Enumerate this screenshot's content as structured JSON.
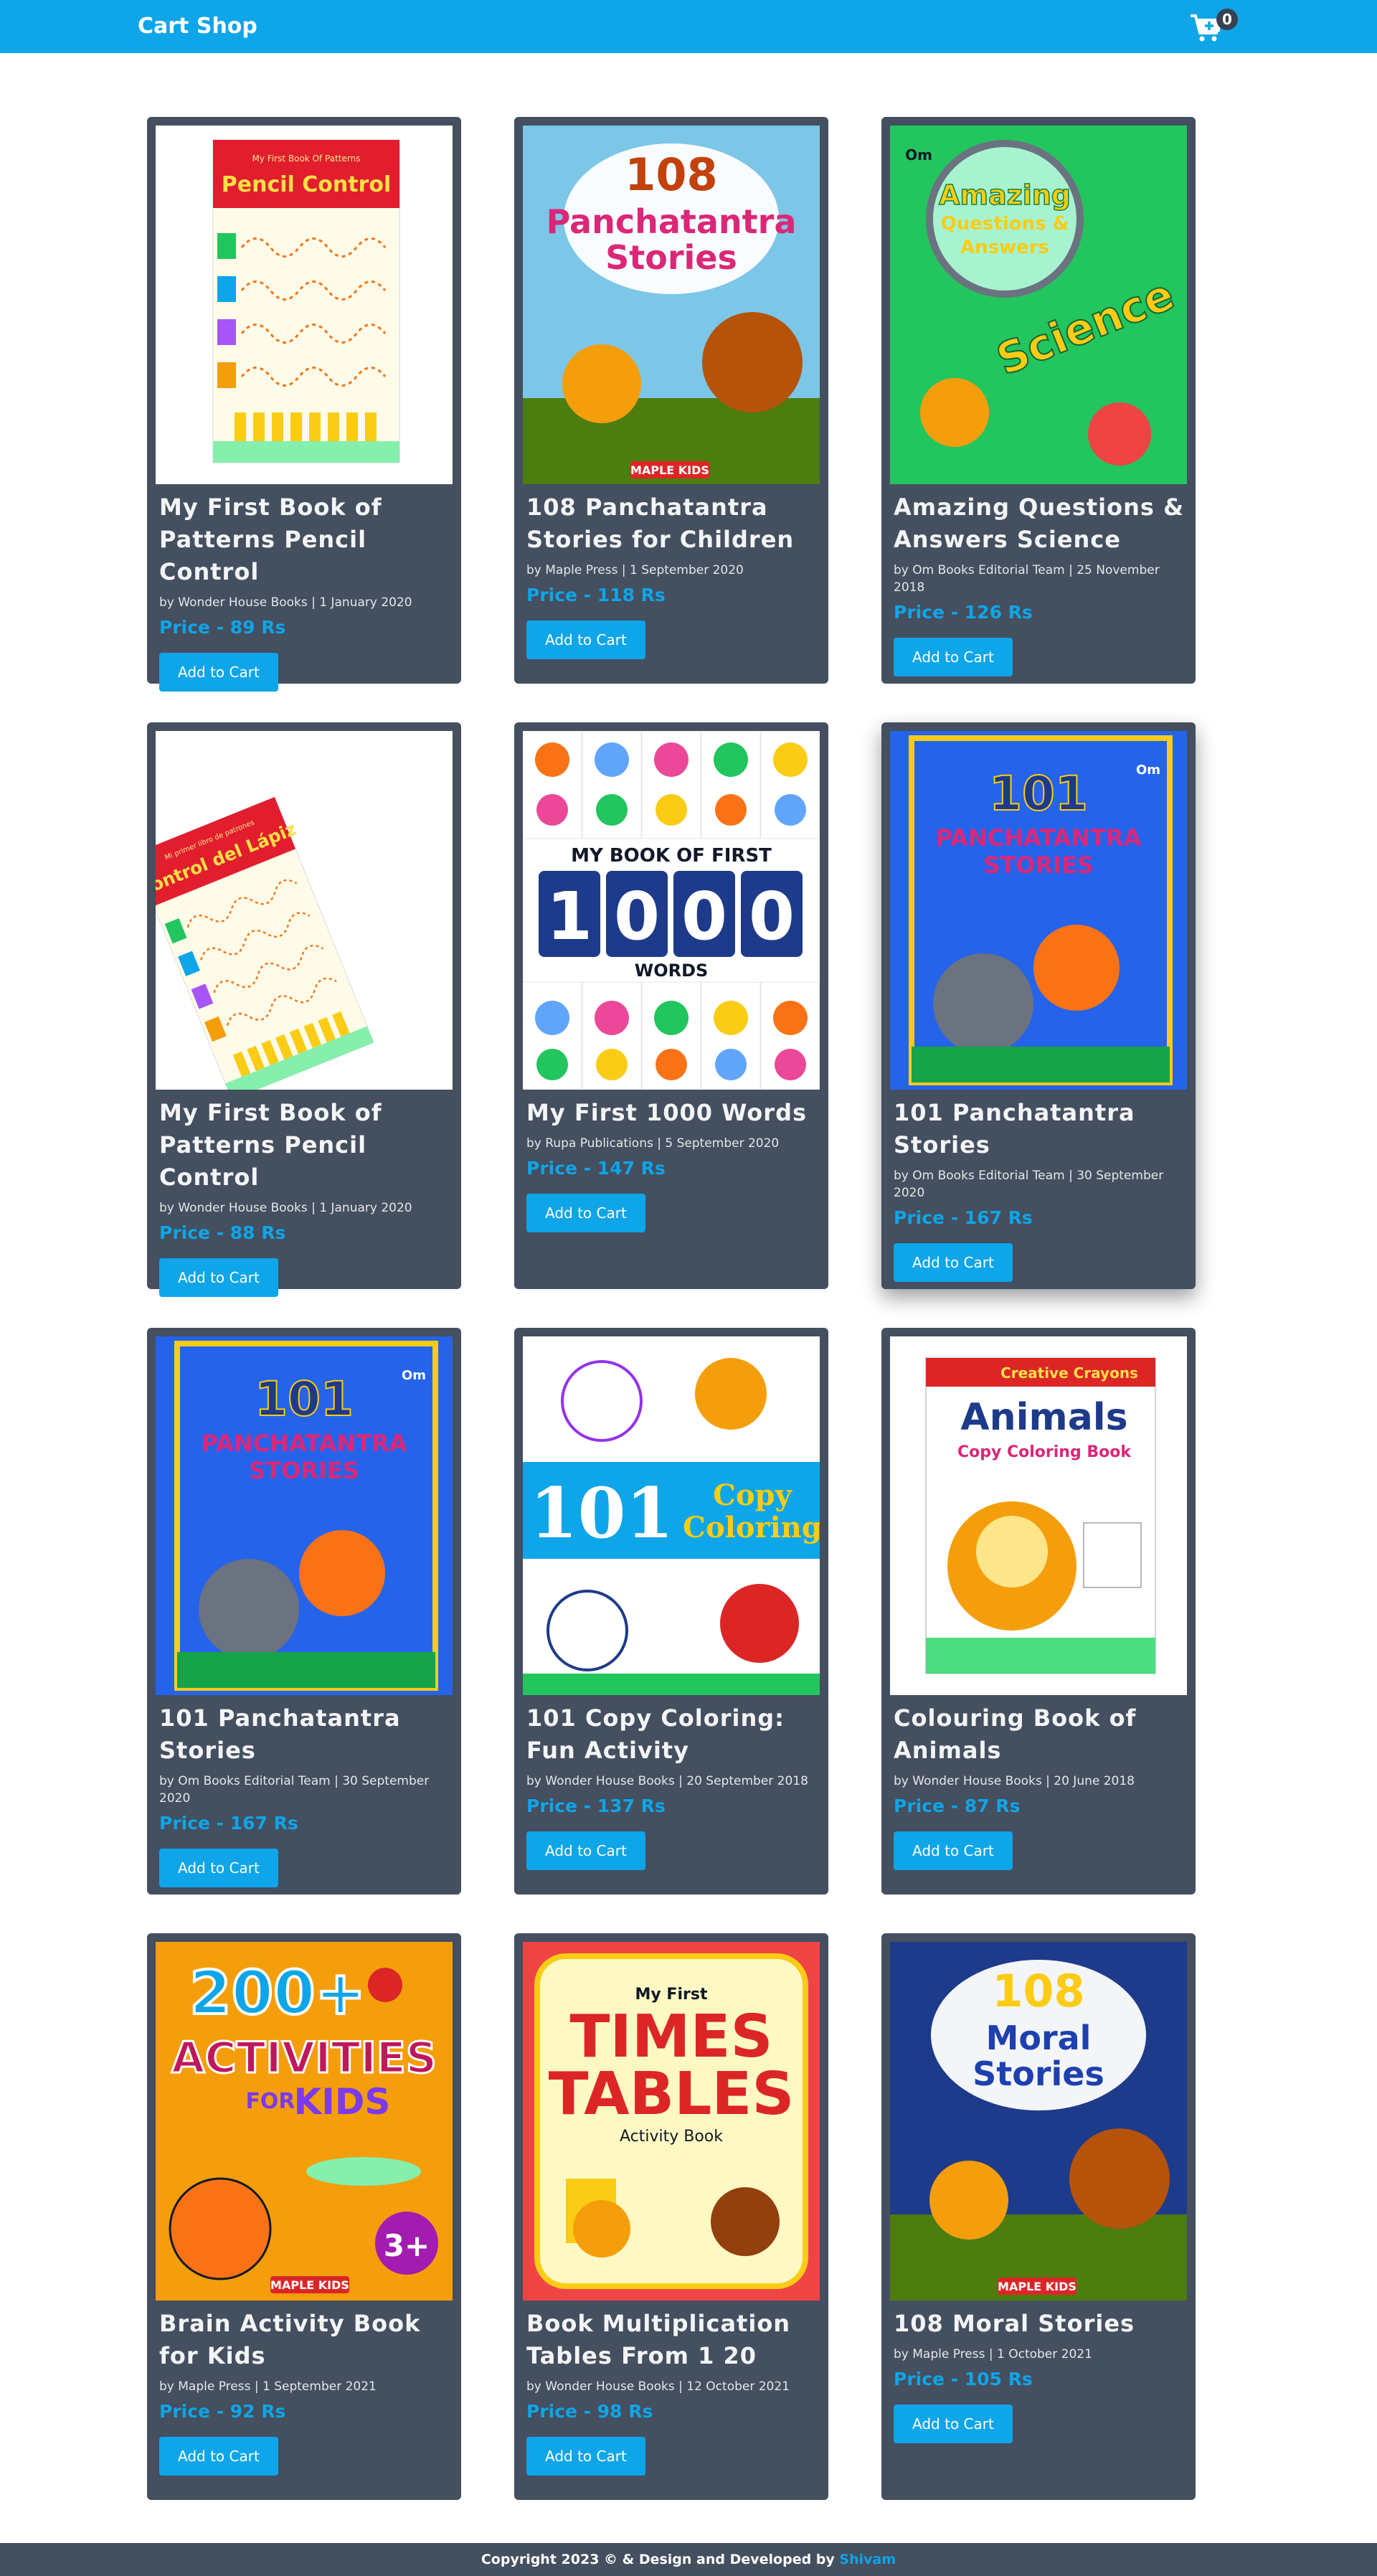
{
  "navbar": {
    "brand": "Cart Shop",
    "cart_icon": "cart-plus-icon",
    "cart_count": "0",
    "color": "#0ea5e9"
  },
  "products": [
    {
      "title": "My First Book of Patterns Pencil Control",
      "meta": "by Wonder House Books | 1 January 2020",
      "price": "Price - 89 Rs",
      "button": "Add to Cart",
      "cover": {
        "lines": [
          "My First Book Of Patterns",
          "Pencil Control"
        ],
        "bg": "#ffffff",
        "accent": "#e11d2e",
        "style": "pencil"
      }
    },
    {
      "title": "108 Panchatantra Stories for Children",
      "meta": "by Maple Press | 1 September 2020",
      "price": "Price - 118 Rs",
      "button": "Add to Cart",
      "cover": {
        "lines": [
          "108",
          "Panchatantra",
          "Stories",
          "MAPLE KIDS"
        ],
        "bg": "#7cc6e8",
        "accent": "#c2410c",
        "style": "animals"
      }
    },
    {
      "title": "Amazing Questions & Answers Science",
      "meta": "by Om Books Editorial Team | 25 November 2018",
      "price": "Price - 126 Rs",
      "button": "Add to Cart",
      "cover": {
        "lines": [
          "Om",
          "Amazing",
          "Questions &",
          "Answers",
          "Science"
        ],
        "bg": "#22c55e",
        "accent": "#facc15",
        "style": "science"
      }
    },
    {
      "title": "My First Book of Patterns Pencil Control",
      "meta": "by Wonder House Books | 1 January 2020",
      "price": "Price - 88 Rs",
      "button": "Add to Cart",
      "cover": {
        "lines": [
          "Mi primer libro de patrones",
          "Control del Lápiz"
        ],
        "bg": "#ffffff",
        "accent": "#e11d2e",
        "style": "pencil-tilt"
      }
    },
    {
      "title": "My First 1000 Words",
      "meta": "by Rupa Publications | 5 September 2020",
      "price": "Price - 147 Rs",
      "button": "Add to Cart",
      "cover": {
        "lines": [
          "MY BOOK OF FIRST",
          "1",
          "0",
          "0",
          "0",
          "WORDS"
        ],
        "bg": "#ffffff",
        "accent": "#1e3a8a",
        "style": "words"
      }
    },
    {
      "title": "101 Panchatantra Stories",
      "meta": "by Om Books Editorial Team | 30 September 2020",
      "price": "Price - 167 Rs",
      "button": "Add to Cart",
      "cover": {
        "lines": [
          "101",
          "PANCHATANTRA",
          "STORIES",
          "Om"
        ],
        "bg": "#2563eb",
        "accent": "#facc15",
        "style": "panchatantra"
      }
    },
    {
      "title": "101 Panchatantra Stories",
      "meta": "by Om Books Editorial Team | 30 September 2020",
      "price": "Price - 167 Rs",
      "button": "Add to Cart",
      "cover": {
        "lines": [
          "101",
          "PANCHATANTRA",
          "STORIES",
          "Om"
        ],
        "bg": "#2563eb",
        "accent": "#facc15",
        "style": "panchatantra"
      }
    },
    {
      "title": "101 Copy Coloring: Fun Activity",
      "meta": "by Wonder House Books | 20 September 2018",
      "price": "Price - 137 Rs",
      "button": "Add to Cart",
      "cover": {
        "lines": [
          "101",
          "Copy",
          "Coloring"
        ],
        "bg": "#ffffff",
        "accent": "#0ea5e9",
        "style": "copy"
      }
    },
    {
      "title": "Colouring Book of Animals",
      "meta": "by Wonder House Books | 20 June 2018",
      "price": "Price - 87 Rs",
      "button": "Add to Cart",
      "cover": {
        "lines": [
          "Creative Crayons",
          "Animals",
          "Copy Coloring Book"
        ],
        "bg": "#ffffff",
        "accent": "#dc2626",
        "style": "animals-copy"
      }
    },
    {
      "title": "Brain Activity Book for Kids",
      "meta": "by Maple Press | 1 September 2021",
      "price": "Price - 92 Rs",
      "button": "Add to Cart",
      "cover": {
        "lines": [
          "200+",
          "ACTIVITIES",
          "FOR",
          "KIDS",
          "3+",
          "MAPLE KIDS"
        ],
        "bg": "#f59e0b",
        "accent": "#be185d",
        "style": "activities"
      }
    },
    {
      "title": "Book Multiplication Tables From 1 20",
      "meta": "by Wonder House Books | 12 October 2021",
      "price": "Price - 98 Rs",
      "button": "Add to Cart",
      "cover": {
        "lines": [
          "My First",
          "TIMES",
          "TABLES",
          "Activity Book"
        ],
        "bg": "#ef4444",
        "accent": "#facc15",
        "style": "tables"
      }
    },
    {
      "title": "108 Moral Stories",
      "meta": "by Maple Press | 1 October 2021",
      "price": "Price - 105 Rs",
      "button": "Add to Cart",
      "cover": {
        "lines": [
          "108",
          "Moral",
          "Stories",
          "MAPLE KIDS"
        ],
        "bg": "#1e3a8a",
        "accent": "#facc15",
        "style": "moral"
      }
    }
  ],
  "footer": {
    "text": "Copyright 2023 © & Design and Developed by",
    "author": "Shivam"
  }
}
